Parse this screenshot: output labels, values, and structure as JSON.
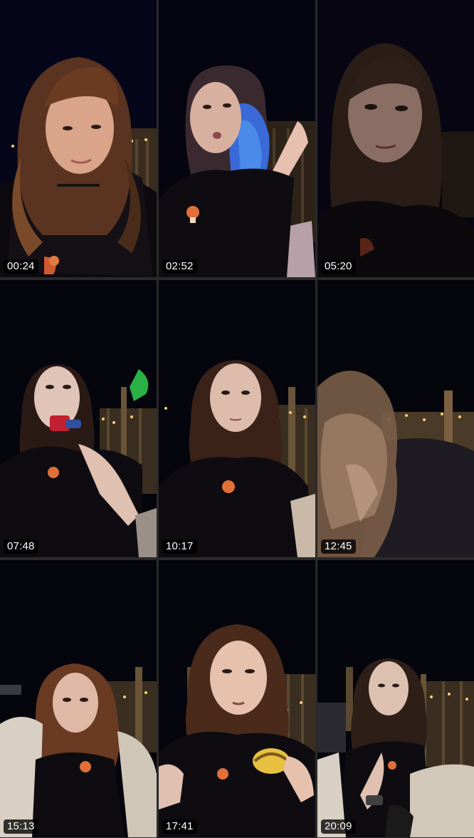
{
  "thumbnails": [
    {
      "timestamp": "00:24"
    },
    {
      "timestamp": "02:52"
    },
    {
      "timestamp": "05:20"
    },
    {
      "timestamp": "07:48"
    },
    {
      "timestamp": "10:17"
    },
    {
      "timestamp": "12:45"
    },
    {
      "timestamp": "15:13"
    },
    {
      "timestamp": "17:41"
    },
    {
      "timestamp": "20:09"
    }
  ]
}
